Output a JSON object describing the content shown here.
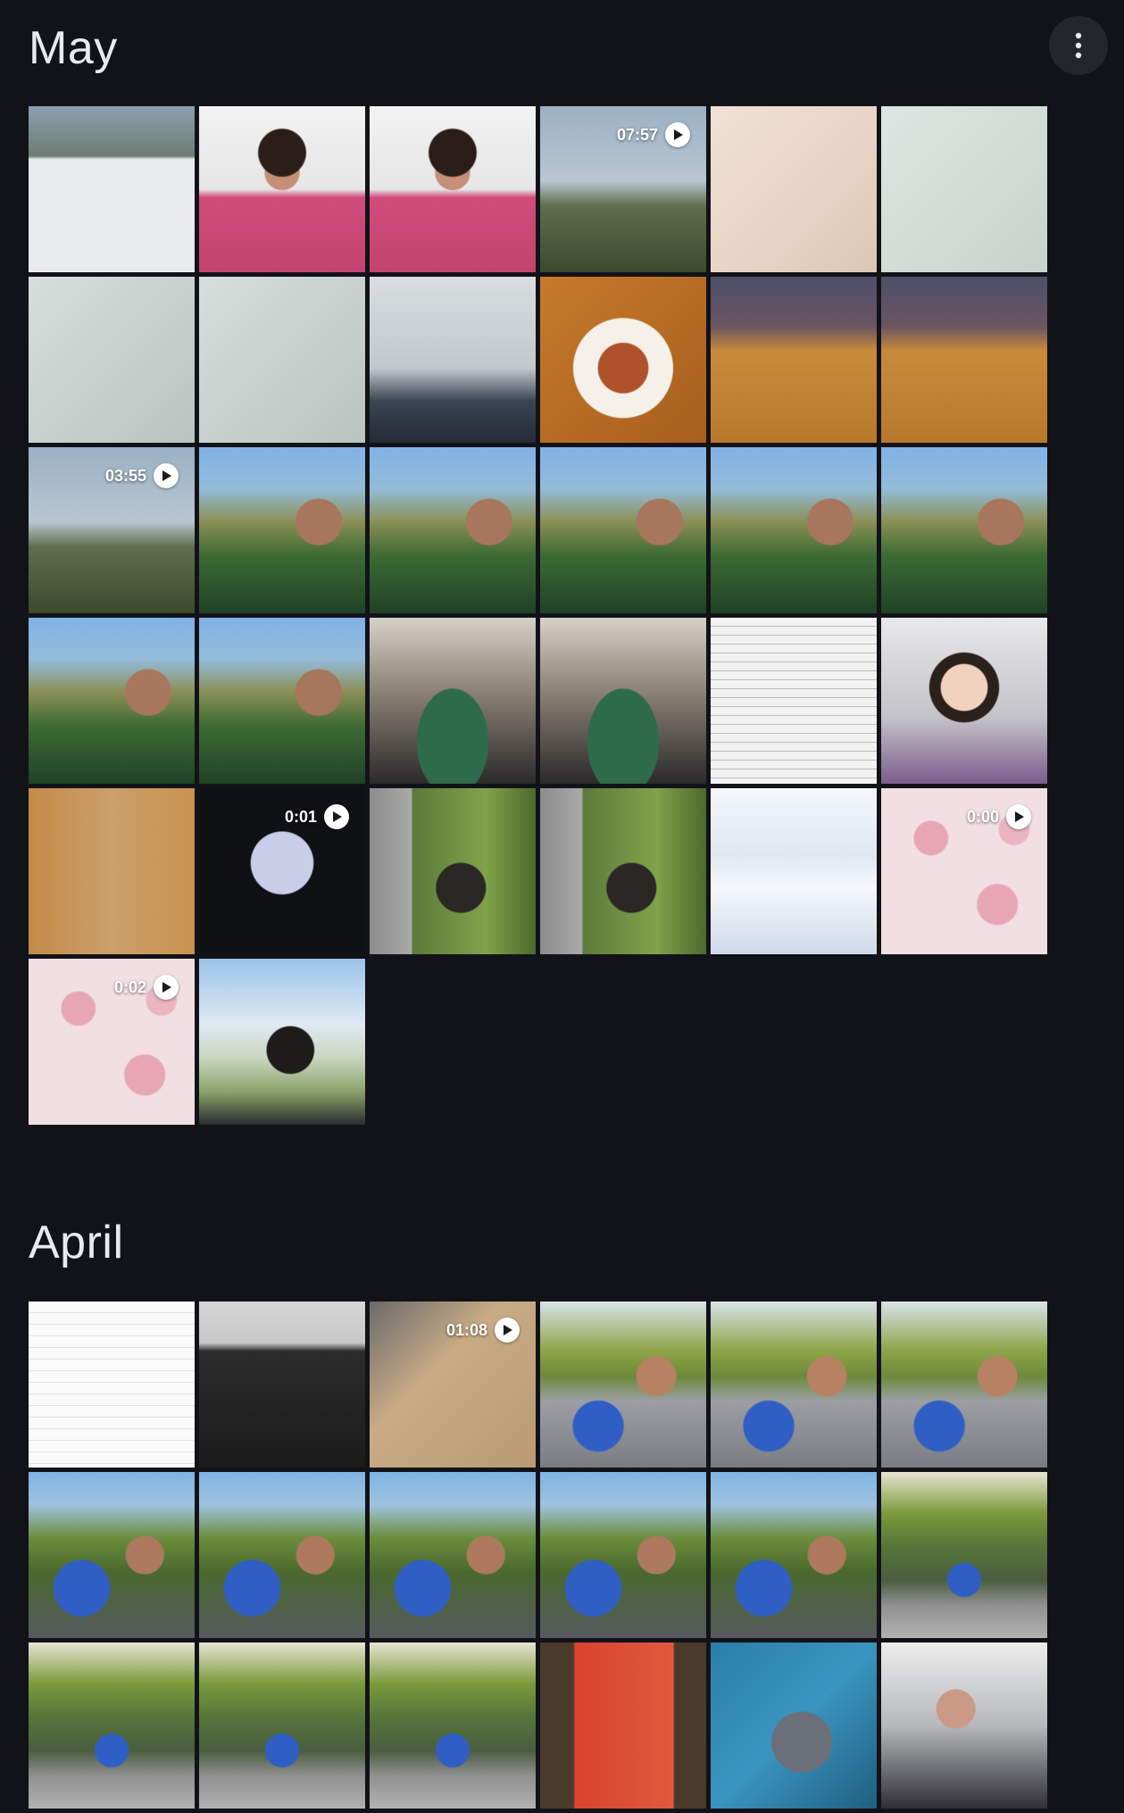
{
  "sections": [
    {
      "title": "May",
      "items": [
        {
          "scene": "sc-screens",
          "duration": ""
        },
        {
          "scene": "sc-girl",
          "duration": ""
        },
        {
          "scene": "sc-girl",
          "duration": ""
        },
        {
          "scene": "sc-game",
          "duration": "07:57"
        },
        {
          "scene": "sc-paper",
          "duration": ""
        },
        {
          "scene": "sc-card",
          "duration": ""
        },
        {
          "scene": "sc-licence",
          "duration": ""
        },
        {
          "scene": "sc-licence",
          "duration": ""
        },
        {
          "scene": "sc-office",
          "duration": ""
        },
        {
          "scene": "sc-food",
          "duration": ""
        },
        {
          "scene": "sc-dinner",
          "duration": ""
        },
        {
          "scene": "sc-dinner",
          "duration": ""
        },
        {
          "scene": "sc-game",
          "duration": "03:55"
        },
        {
          "scene": "sc-selfie",
          "duration": ""
        },
        {
          "scene": "sc-selfie",
          "duration": ""
        },
        {
          "scene": "sc-selfie",
          "duration": ""
        },
        {
          "scene": "sc-selfie",
          "duration": ""
        },
        {
          "scene": "sc-selfie",
          "duration": ""
        },
        {
          "scene": "sc-selfie",
          "duration": ""
        },
        {
          "scene": "sc-selfie",
          "duration": ""
        },
        {
          "scene": "sc-poker",
          "duration": ""
        },
        {
          "scene": "sc-poker",
          "duration": ""
        },
        {
          "scene": "sc-doc",
          "duration": ""
        },
        {
          "scene": "sc-avatar",
          "duration": ""
        },
        {
          "scene": "sc-notice",
          "duration": ""
        },
        {
          "scene": "sc-tablet",
          "duration": "0:01"
        },
        {
          "scene": "sc-cat-win",
          "duration": ""
        },
        {
          "scene": "sc-cat-win",
          "duration": ""
        },
        {
          "scene": "sc-flyer",
          "duration": ""
        },
        {
          "scene": "sc-pink",
          "duration": "0:00"
        },
        {
          "scene": "sc-pink",
          "duration": "0:02"
        },
        {
          "scene": "sc-cat-sky",
          "duration": ""
        }
      ]
    },
    {
      "title": "April",
      "items": [
        {
          "scene": "sc-note",
          "duration": ""
        },
        {
          "scene": "sc-keyboard",
          "duration": ""
        },
        {
          "scene": "sc-box",
          "duration": "01:08"
        },
        {
          "scene": "sc-park",
          "duration": ""
        },
        {
          "scene": "sc-park",
          "duration": ""
        },
        {
          "scene": "sc-park",
          "duration": ""
        },
        {
          "scene": "sc-pond-selfie",
          "duration": ""
        },
        {
          "scene": "sc-pond-selfie",
          "duration": ""
        },
        {
          "scene": "sc-pond-selfie",
          "duration": ""
        },
        {
          "scene": "sc-pond-selfie",
          "duration": ""
        },
        {
          "scene": "sc-pond-selfie",
          "duration": ""
        },
        {
          "scene": "sc-pond",
          "duration": ""
        },
        {
          "scene": "sc-pond",
          "duration": ""
        },
        {
          "scene": "sc-pond",
          "duration": ""
        },
        {
          "scene": "sc-pond",
          "duration": ""
        },
        {
          "scene": "sc-banner",
          "duration": ""
        },
        {
          "scene": "sc-cat-bag",
          "duration": ""
        },
        {
          "scene": "sc-kids",
          "duration": ""
        }
      ]
    }
  ],
  "header": {
    "more_icon": "more-vert-icon"
  },
  "colors": {
    "background": "#121318",
    "text": "#e8eaed",
    "button_bg": "#24262c"
  }
}
